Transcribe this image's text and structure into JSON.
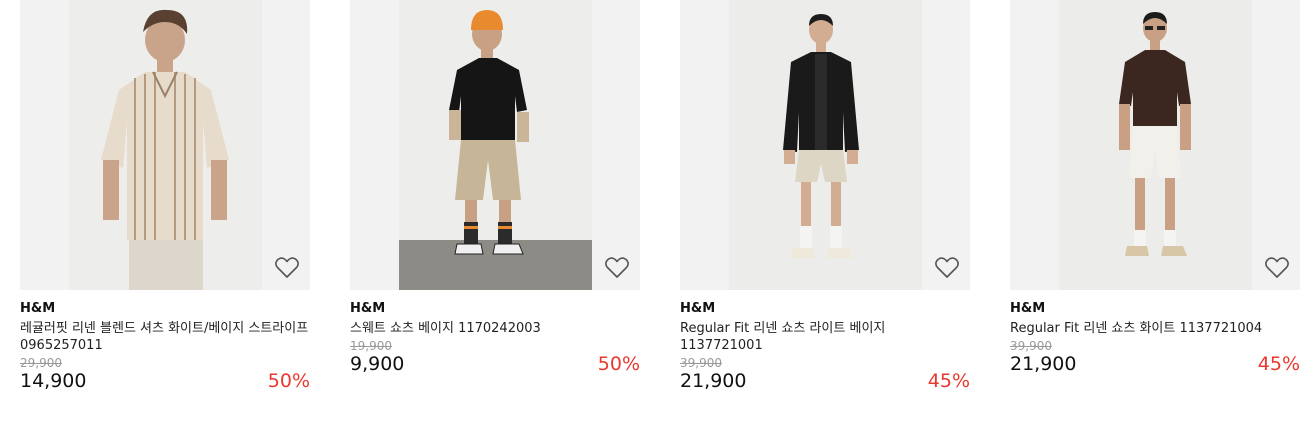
{
  "products": [
    {
      "brand": "H&M",
      "name": "레귤러핏 리넨 블렌드 셔츠 화이트/베이지 스트라이프 0965257011",
      "original_price": "29,900",
      "sale_price": "14,900",
      "discount": "50%",
      "image_desc": "striped beige linen shirt"
    },
    {
      "brand": "H&M",
      "name": "스웨트 쇼츠 베이지 1170242003",
      "original_price": "19,900",
      "sale_price": "9,900",
      "discount": "50%",
      "image_desc": "beige sweat shorts with black tee"
    },
    {
      "brand": "H&M",
      "name": "Regular Fit 리넨 쇼츠 라이트 베이지 1137721001",
      "original_price": "39,900",
      "sale_price": "21,900",
      "discount": "45%",
      "image_desc": "light beige linen shorts with black jacket"
    },
    {
      "brand": "H&M",
      "name": "Regular Fit 리넨 쇼츠 화이트 1137721004",
      "original_price": "39,900",
      "sale_price": "21,900",
      "discount": "45%",
      "image_desc": "white linen shorts with brown shirt"
    }
  ],
  "colors": {
    "discount": "#e8392e",
    "original_price": "#999999",
    "image_bg": "#f2f2f2"
  },
  "icons": {
    "wishlist": "heart-outline-icon"
  }
}
